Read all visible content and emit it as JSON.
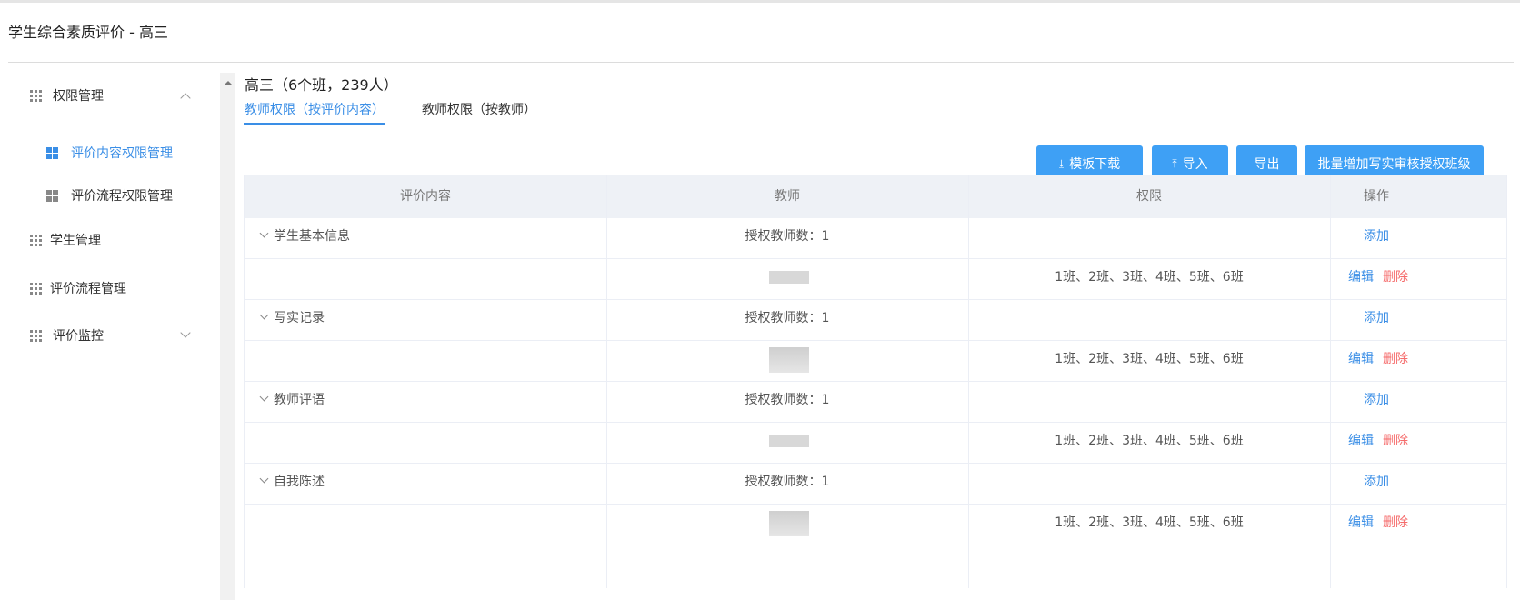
{
  "app": {
    "title": "学生综合素质评价 - 高三"
  },
  "sidebar": {
    "items": [
      {
        "label": "权限管理",
        "expanded": true,
        "icon": "grid-icon"
      },
      {
        "label": "评价内容权限管理",
        "active": true,
        "icon": "quad-icon"
      },
      {
        "label": "评价流程权限管理",
        "active": false,
        "icon": "quad-icon"
      },
      {
        "label": "学生管理",
        "icon": "grid-icon"
      },
      {
        "label": "评价流程管理",
        "icon": "grid-icon"
      },
      {
        "label": "评价监控",
        "expanded": false,
        "icon": "grid-icon"
      }
    ]
  },
  "main": {
    "grade_title": "高三（6个班，239人）",
    "tabs": [
      {
        "label": "教师权限（按评价内容）",
        "active": true
      },
      {
        "label": "教师权限（按教师）",
        "active": false
      }
    ],
    "toolbar": {
      "download_template": "模板下载",
      "import": "导入",
      "export": "导出",
      "batch_add": "批量增加写实审核授权班级"
    },
    "table": {
      "headers": [
        "评价内容",
        "教师",
        "权限",
        "操作"
      ],
      "groups": [
        {
          "content": "学生基本信息",
          "teacher_count": "授权教师数：1",
          "add": "添加",
          "permission": "1班、2班、3班、4班、5班、6班",
          "edit": "编辑",
          "delete": "删除"
        },
        {
          "content": "写实记录",
          "teacher_count": "授权教师数：1",
          "add": "添加",
          "permission": "1班、2班、3班、4班、5班、6班",
          "edit": "编辑",
          "delete": "删除"
        },
        {
          "content": "教师评语",
          "teacher_count": "授权教师数：1",
          "add": "添加",
          "permission": "1班、2班、3班、4班、5班、6班",
          "edit": "编辑",
          "delete": "删除"
        },
        {
          "content": "自我陈述",
          "teacher_count": "授权教师数：1",
          "add": "添加",
          "permission": "1班、2班、3班、4班、5班、6班",
          "edit": "编辑",
          "delete": "删除"
        }
      ]
    }
  },
  "colors": {
    "accent": "#3a8ee6",
    "button": "#3ea0f5",
    "danger": "#f56c6c",
    "header_bg": "#eef1f6"
  }
}
